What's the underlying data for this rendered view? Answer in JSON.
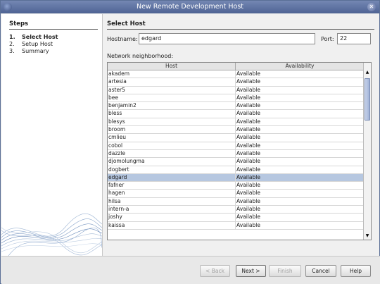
{
  "window": {
    "title": "New Remote Development Host",
    "icon": "app-icon",
    "close_icon": "close-icon"
  },
  "steps": {
    "title": "Steps",
    "items": [
      {
        "num": "1.",
        "label": "Select Host"
      },
      {
        "num": "2.",
        "label": "Setup Host"
      },
      {
        "num": "3.",
        "label": "Summary"
      }
    ]
  },
  "panel": {
    "title": "Select Host",
    "hostname_label": "Hostname:",
    "hostname_value": "edgard",
    "port_label": "Port:",
    "port_value": "22",
    "network_label": "Network neighborhood:"
  },
  "table": {
    "columns": [
      "Host",
      "Availability"
    ],
    "rows": [
      [
        "akadem",
        "Available"
      ],
      [
        "artesia",
        "Available"
      ],
      [
        "aster5",
        "Available"
      ],
      [
        "bee",
        "Available"
      ],
      [
        "benjamin2",
        "Available"
      ],
      [
        "bless",
        "Available"
      ],
      [
        "blesys",
        "Available"
      ],
      [
        "broom",
        "Available"
      ],
      [
        "cmlieu",
        "Available"
      ],
      [
        "cobol",
        "Available"
      ],
      [
        "dazzle",
        "Available"
      ],
      [
        "djomolungma",
        "Available"
      ],
      [
        "dogbert",
        "Available"
      ],
      [
        "edgard",
        "Available"
      ],
      [
        "fafner",
        "Available"
      ],
      [
        "hagen",
        "Available"
      ],
      [
        "hilsa",
        "Available"
      ],
      [
        "intern-a",
        "Available"
      ],
      [
        "joshy",
        "Available"
      ],
      [
        "kaissa",
        "Available"
      ]
    ],
    "selected_index": 13
  },
  "buttons": {
    "back": "< Back",
    "next": "Next >",
    "finish": "Finish",
    "cancel": "Cancel",
    "help": "Help"
  }
}
